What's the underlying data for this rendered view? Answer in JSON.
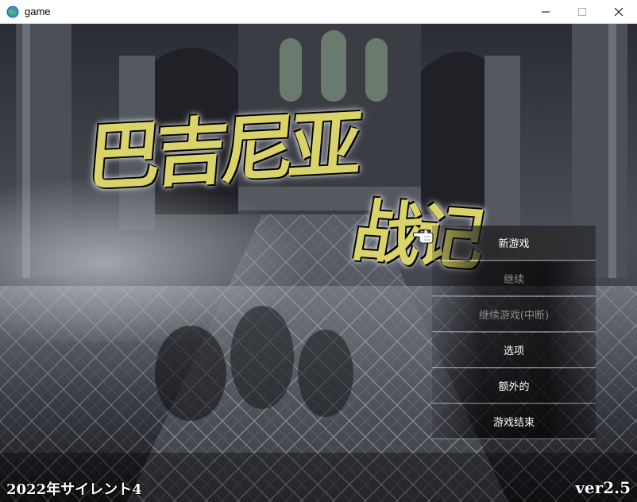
{
  "window": {
    "title": "game",
    "icon": "globe-icon",
    "controls": [
      "minimize-icon",
      "maximize-icon",
      "close-icon"
    ]
  },
  "title_screen": {
    "logo_line1": "巴吉尼亚",
    "logo_line2": "战记",
    "menu": [
      {
        "label": "新游戏",
        "enabled": true,
        "selected": true
      },
      {
        "label": "继续",
        "enabled": false,
        "selected": false
      },
      {
        "label": "继续游戏(中断)",
        "enabled": false,
        "selected": false
      },
      {
        "label": "选项",
        "enabled": true,
        "selected": false
      },
      {
        "label": "额外的",
        "enabled": true,
        "selected": false
      },
      {
        "label": "游戏结束",
        "enabled": true,
        "selected": false
      }
    ],
    "cursor_icon": "pointing-hand-icon",
    "copyright": "2022年サイレント4",
    "version": "ver2.5"
  },
  "colors": {
    "logo_fill": "#d9d36a",
    "menu_text": "#ffffff",
    "menu_text_disabled": "#8c8c8c"
  }
}
